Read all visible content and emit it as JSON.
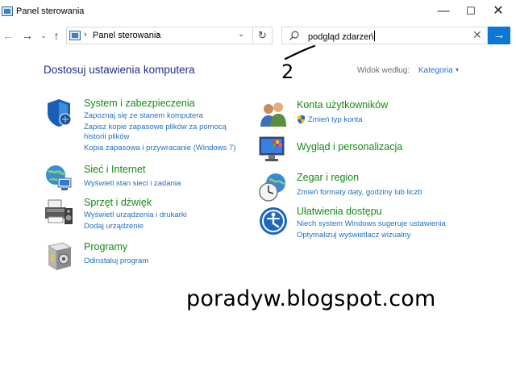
{
  "window": {
    "title": "Panel sterowania",
    "minimize_glyph": "—",
    "maximize_glyph": "☐",
    "close_glyph": "✕"
  },
  "navigation": {
    "back_glyph": "←",
    "forward_glyph": "→",
    "recent_glyph": "⌄",
    "up_glyph": "↑",
    "address_path": "Panel sterowania",
    "address_separator": "›",
    "address_dropdown_glyph": "⌄",
    "refresh_glyph": "↻"
  },
  "search": {
    "value": "podgląd zdarzeń",
    "clear_glyph": "✕",
    "go_glyph": "→"
  },
  "annotation": {
    "number": "2"
  },
  "header": {
    "title": "Dostosuj ustawienia komputera",
    "view_by_label": "Widok według:",
    "view_by_value": "Kategoria",
    "view_by_arrow": "▾"
  },
  "categories": [
    {
      "icon": "security-shield-icon",
      "title": "System i zabezpieczenia",
      "links": [
        "Zapoznaj się ze stanem komputera",
        "Zapisz kopie zapasowe plików za pomocą",
        "historii plików",
        "Kopia zapasowa i przywracanie (Windows 7)"
      ]
    },
    {
      "icon": "network-globe-icon",
      "title": "Sieć i Internet",
      "links": [
        "Wyświetl stan sieci i zadania"
      ]
    },
    {
      "icon": "printer-speaker-icon",
      "title": "Sprzęt i dźwięk",
      "links": [
        "Wyświetl urządzenia i drukarki",
        "Dodaj urządzenie"
      ]
    },
    {
      "icon": "programs-box-icon",
      "title": "Programy",
      "links": [
        "Odinstaluj program"
      ]
    },
    {
      "icon": "user-accounts-icon",
      "title": "Konta użytkowników",
      "links": [
        "Zmień typ konta"
      ]
    },
    {
      "icon": "appearance-monitor-icon",
      "title": "Wygląd i personalizacja",
      "links": []
    },
    {
      "icon": "clock-globe-icon",
      "title": "Zegar i region",
      "links": [
        "Zmień formaty daty, godziny lub liczb"
      ]
    },
    {
      "icon": "ease-of-access-icon",
      "title": "Ułatwienia dostępu",
      "links": [
        "Niech system Windows sugeruje ustawienia",
        "Optymalizuj wyświetlacz wizualny"
      ]
    }
  ],
  "watermark": "poradyw.blogspot.com",
  "colors": {
    "link": "#1f6fc5",
    "category_title": "#128c12",
    "page_title": "#1e3287",
    "accent": "#0b78d7"
  }
}
